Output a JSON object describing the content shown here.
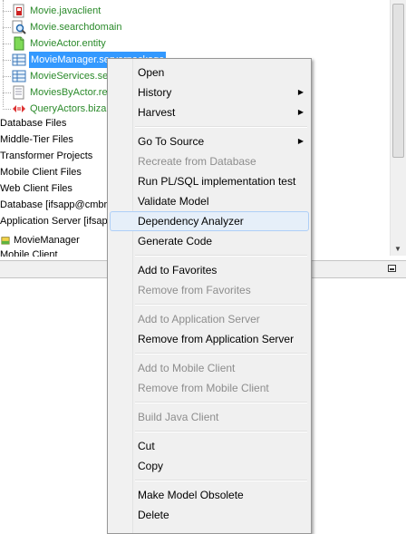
{
  "tree": {
    "items": [
      {
        "label": "Movie.javaclient",
        "icon": "java-client-icon"
      },
      {
        "label": "Movie.searchdomain",
        "icon": "search-domain-icon"
      },
      {
        "label": "MovieActor.entity",
        "icon": "entity-file-icon"
      },
      {
        "label": "MovieManager.serverpackage",
        "icon": "server-package-icon"
      },
      {
        "label": "MovieServices.se",
        "icon": "server-package-icon"
      },
      {
        "label": "MoviesByActor.re",
        "icon": "report-file-icon"
      },
      {
        "label": "QueryActors.biza",
        "icon": "business-activity-icon"
      }
    ],
    "top_nodes": [
      "Database Files",
      "Middle-Tier Files",
      "Transformer Projects",
      "Mobile Client Files",
      "Web Client Files",
      "Database [ifsapp@cmbrn",
      "Application Server [ifsapp"
    ],
    "child": {
      "label": "MovieManager",
      "icon": "movie-manager-icon"
    },
    "partial": "Mobile Client"
  },
  "menu": {
    "open": "Open",
    "history": "History",
    "harvest": "Harvest",
    "go_to_source": "Go To Source",
    "recreate_from_database": "Recreate from Database",
    "run_plsql_test": "Run PL/SQL implementation test",
    "validate_model": "Validate Model",
    "dependency_analyzer": "Dependency Analyzer",
    "generate_code": "Generate Code",
    "add_to_favorites": "Add to Favorites",
    "remove_from_favorites": "Remove from Favorites",
    "add_to_application_server": "Add to Application Server",
    "remove_from_application_server": "Remove from Application Server",
    "add_to_mobile_client": "Add to Mobile Client",
    "remove_from_mobile_client": "Remove from Mobile Client",
    "build_java_client": "Build Java Client",
    "cut": "Cut",
    "copy": "Copy",
    "make_model_obsolete": "Make Model Obsolete",
    "delete": "Delete"
  },
  "colors": {
    "selection": "#3399ff",
    "green_text": "#2a8a2a",
    "disabled_text": "#8d8d8d",
    "hover_fill": "#e6eff9"
  }
}
